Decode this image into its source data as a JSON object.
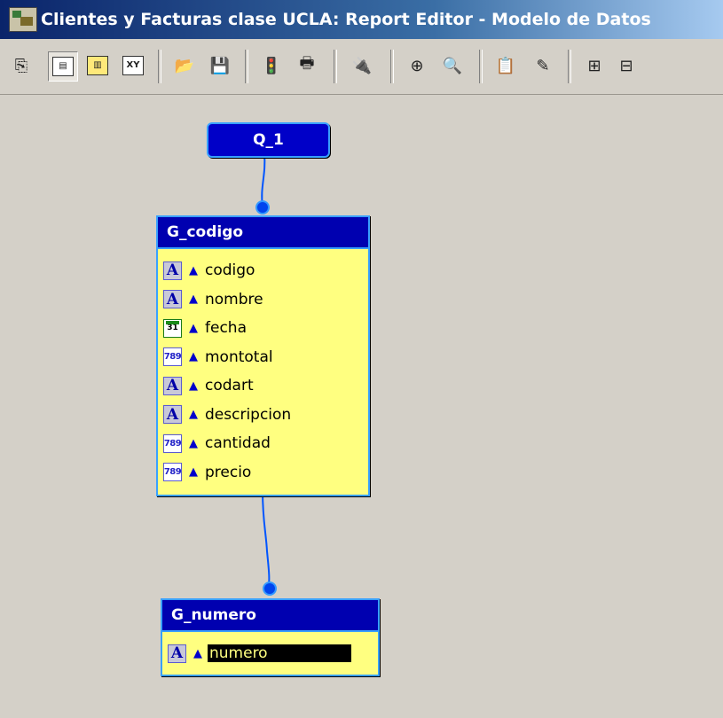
{
  "window": {
    "title": "Clientes y Facturas clase UCLA: Report Editor - Modelo de Datos",
    "icon": "report-builder-icon"
  },
  "toolbar": {
    "buttons": [
      {
        "name": "data-wizard",
        "icon": "magnify-document-icon",
        "label": "⎘"
      },
      {
        "name": "data-model",
        "icon": "data-model-icon",
        "label": "▤"
      },
      {
        "name": "layout-model",
        "icon": "layout-model-icon",
        "label": "▥"
      },
      {
        "name": "cross-product",
        "icon": "xy-icon",
        "label": "XY"
      },
      {
        "name": "open",
        "icon": "open-folder-icon",
        "label": "📂"
      },
      {
        "name": "save",
        "icon": "save-disk-icon",
        "label": "💾"
      },
      {
        "name": "run",
        "icon": "traffic-light-icon",
        "label": "🚦"
      },
      {
        "name": "print",
        "icon": "print-icon",
        "label": "🖶"
      },
      {
        "name": "connect",
        "icon": "plug-icon",
        "label": "🔌"
      },
      {
        "name": "zoom-in",
        "icon": "zoom-in-icon",
        "label": "⊕"
      },
      {
        "name": "zoom-out",
        "icon": "zoom-out-icon",
        "label": "🔍"
      },
      {
        "name": "property-inspector",
        "icon": "property-sheet-icon",
        "label": "📋"
      },
      {
        "name": "edit",
        "icon": "edit-pencil-icon",
        "label": "✎"
      },
      {
        "name": "expand",
        "icon": "plus-box-icon",
        "label": "⊞"
      },
      {
        "name": "collapse",
        "icon": "minus-box-icon",
        "label": "⊟"
      }
    ]
  },
  "diagram": {
    "query": {
      "name": "Q_1"
    },
    "groups": [
      {
        "name": "G_codigo",
        "items": [
          {
            "name": "codigo",
            "type": "char",
            "icon_text": "A"
          },
          {
            "name": "nombre",
            "type": "char",
            "icon_text": "A"
          },
          {
            "name": "fecha",
            "type": "date",
            "icon_text": "31"
          },
          {
            "name": "montotal",
            "type": "number",
            "icon_text": "789"
          },
          {
            "name": "codart",
            "type": "char",
            "icon_text": "A"
          },
          {
            "name": "descripcion",
            "type": "char",
            "icon_text": "A"
          },
          {
            "name": "cantidad",
            "type": "number",
            "icon_text": "789"
          },
          {
            "name": "precio",
            "type": "number",
            "icon_text": "789"
          }
        ]
      },
      {
        "name": "G_numero",
        "items": [
          {
            "name": "numero",
            "type": "char",
            "icon_text": "A",
            "selected": true
          }
        ]
      }
    ]
  },
  "colors": {
    "canvas": "#d4d0c8",
    "group_body": "#ffff80",
    "group_header": "#0000b0",
    "group_border": "#39a0ff",
    "link": "#0055ff"
  }
}
